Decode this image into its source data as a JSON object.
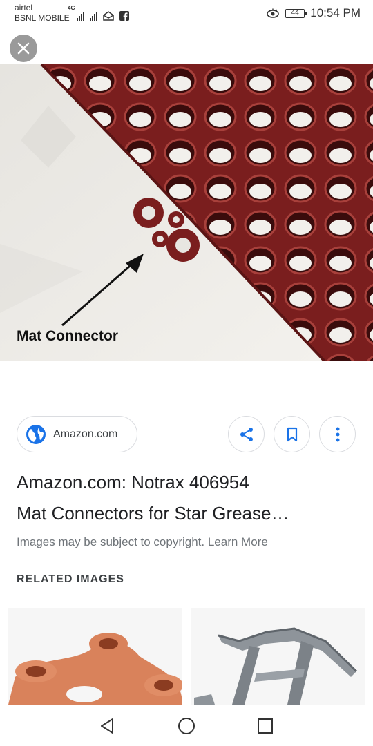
{
  "status_bar": {
    "carrier_1": "airtel",
    "carrier_2": "BSNL MOBILE",
    "network": "4G",
    "battery": "44",
    "time": "10:54 PM"
  },
  "image": {
    "caption": "Mat Connector",
    "mat_color": "#7a1e1e"
  },
  "source": {
    "site": "Amazon.com",
    "icon": "globe-icon"
  },
  "actions": {
    "share_icon": "share-icon",
    "save_icon": "bookmark-icon",
    "more_icon": "more-vert-icon"
  },
  "result": {
    "title_line1": "Amazon.com: Notrax 406954",
    "title_line2": "Mat Connectors for Star Grease…",
    "copyright": "Images may be subject to copyright. Learn More"
  },
  "related": {
    "heading": "RELATED IMAGES"
  },
  "nav": {
    "back_icon": "back-triangle-icon",
    "home_icon": "home-circle-icon",
    "recent_icon": "recents-square-icon"
  },
  "colors": {
    "accent": "#1a73e8",
    "mat": "#7a1e1e",
    "connector_orange": "#d9825b"
  }
}
